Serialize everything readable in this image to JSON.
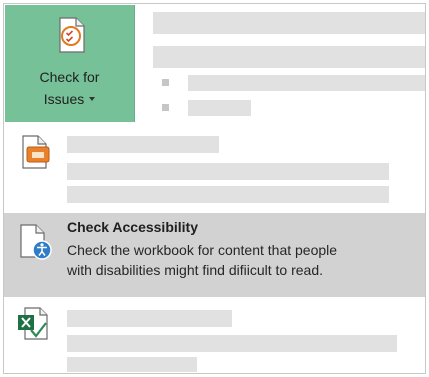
{
  "ribbon": {
    "check_for_issues": {
      "label_line1": "Check for",
      "label_line2": "Issues",
      "icon": "document-check-icon"
    }
  },
  "menu": {
    "items": [
      {
        "id": "placeholder-1",
        "icon": "document-presentation-icon",
        "title": "",
        "description": ""
      },
      {
        "id": "check-accessibility",
        "icon": "accessibility-check-icon",
        "title": "Check Accessibility",
        "description_line1": "Check the workbook for content that people",
        "description_line2": "with disabilities might find difiicult to read.",
        "state": "hovered"
      },
      {
        "id": "placeholder-2",
        "icon": "excel-compatibility-icon",
        "title": "",
        "description": ""
      }
    ]
  },
  "colors": {
    "ribbon_button_active": "#77c199",
    "menu_hover": "#d2d2d2",
    "placeholder_bar": "#e1e1e1"
  }
}
